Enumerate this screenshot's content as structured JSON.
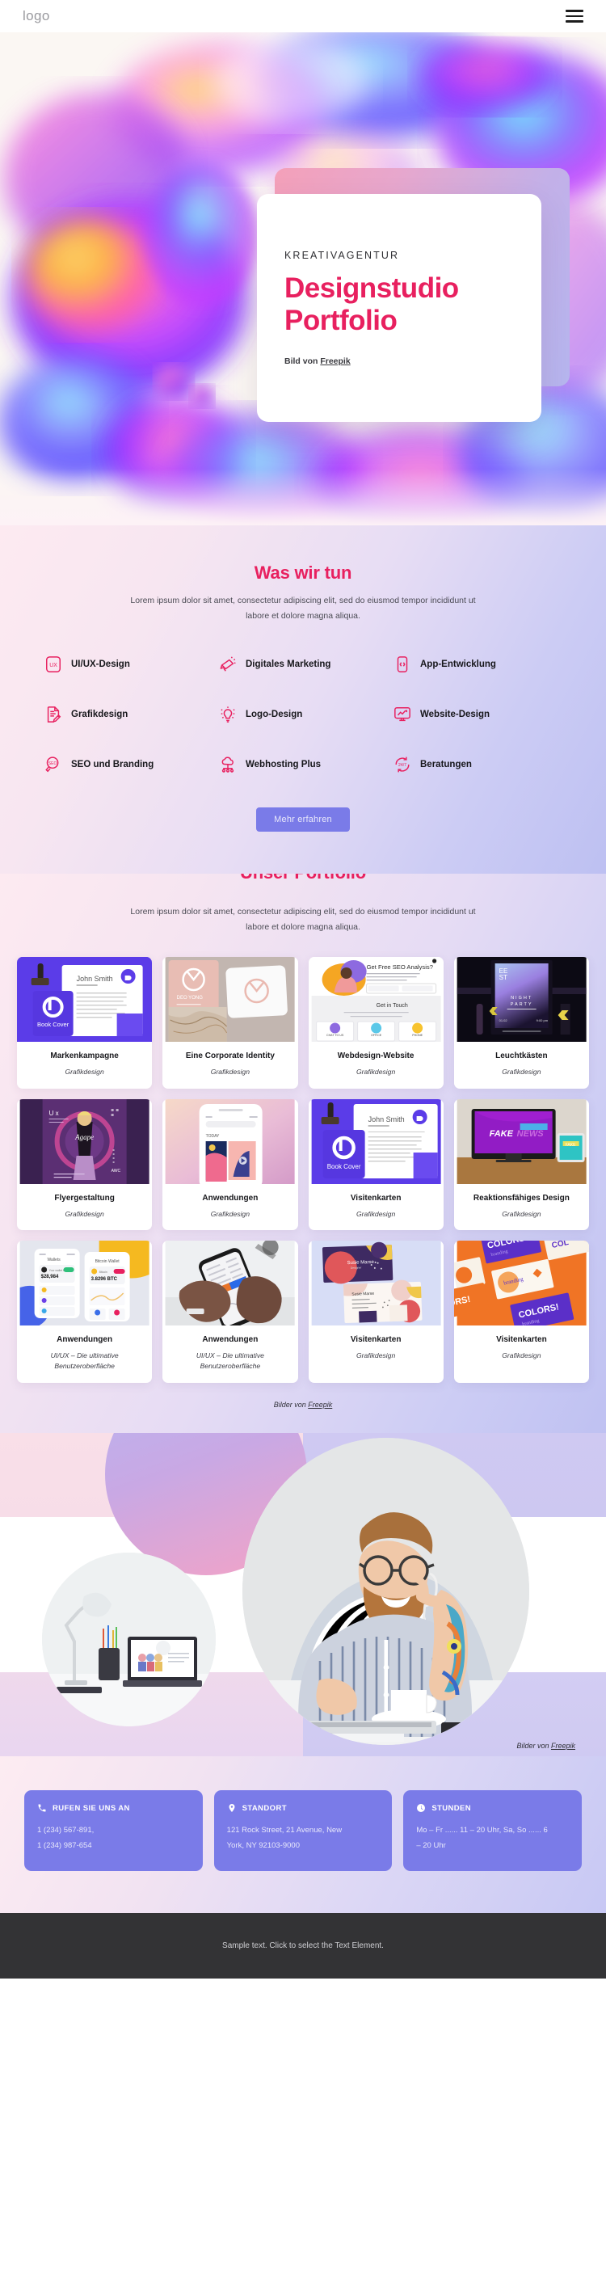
{
  "header": {
    "logo": "logo",
    "menu_icon": "hamburger-menu-icon"
  },
  "hero": {
    "kicker": "KREATIVAGENTUR",
    "title_line1": "Designstudio",
    "title_line2": "Portfolio",
    "credit_prefix": "Bild von ",
    "credit_link": "Freepik"
  },
  "services": {
    "title": "Was wir tun",
    "subtitle": "Lorem ipsum dolor sit amet, consectetur adipiscing elit, sed do eiusmod tempor incididunt ut labore et dolore magna aliqua.",
    "items": [
      {
        "label": "UI/UX-Design",
        "icon": "ux-badge-icon"
      },
      {
        "label": "Digitales Marketing",
        "icon": "megaphone-icon"
      },
      {
        "label": "App-Entwicklung",
        "icon": "mobile-code-icon"
      },
      {
        "label": "Grafikdesign",
        "icon": "document-pen-icon"
      },
      {
        "label": "Logo-Design",
        "icon": "lightbulb-icon"
      },
      {
        "label": "Website-Design",
        "icon": "monitor-chart-icon"
      },
      {
        "label": "SEO und Branding",
        "icon": "seo-magnifier-icon"
      },
      {
        "label": "Webhosting Plus",
        "icon": "cloud-network-icon"
      },
      {
        "label": "Beratungen",
        "icon": "247-refresh-icon"
      }
    ],
    "cta": "Mehr erfahren",
    "accent": "#e8205f",
    "button_color": "#7a7be8"
  },
  "portfolio": {
    "title": "Unser Portfolio",
    "subtitle": "Lorem ipsum dolor sit amet, consectetur adipiscing elit, sed do eiusmod tempor incididunt ut labore et dolore magna aliqua.",
    "credit_prefix": "Bilder von ",
    "credit_link": "Freepik",
    "items": [
      {
        "title": "Markenkampagne",
        "category": "Grafikdesign",
        "art": "brand-stationery"
      },
      {
        "title": "Eine Corporate Identity",
        "category": "Grafikdesign",
        "art": "corporate-identity"
      },
      {
        "title": "Webdesign-Website",
        "category": "Grafikdesign",
        "art": "seo-landing"
      },
      {
        "title": "Leuchtkästen",
        "category": "Grafikdesign",
        "art": "lightbox-poster"
      },
      {
        "title": "Flyergestaltung",
        "category": "Grafikdesign",
        "art": "flyer-purple"
      },
      {
        "title": "Anwendungen",
        "category": "Grafikdesign",
        "art": "phone-mockup"
      },
      {
        "title": "Visitenkarten",
        "category": "Grafikdesign",
        "art": "brand-stationery"
      },
      {
        "title": "Reaktionsfähiges Design",
        "category": "Grafikdesign",
        "art": "fakenews-imac"
      },
      {
        "title": "Anwendungen",
        "category": "UI/UX – Die ultimative Benutzeroberfläche",
        "art": "wallet-apps"
      },
      {
        "title": "Anwendungen",
        "category": "UI/UX – Die ultimative Benutzeroberfläche",
        "art": "hands-phone"
      },
      {
        "title": "Visitenkarten",
        "category": "Grafikdesign",
        "art": "cards-pastel"
      },
      {
        "title": "Visitenkarten",
        "category": "Grafikdesign",
        "art": "colors-orange"
      }
    ]
  },
  "team": {
    "credit_prefix": "Bilder von ",
    "credit_link": "Freepik"
  },
  "contact": {
    "cards": [
      {
        "icon": "phone-icon",
        "title": "RUFEN SIE UNS AN",
        "line1": "1 (234) 567-891,",
        "line2": "1 (234) 987-654"
      },
      {
        "icon": "location-icon",
        "title": "STANDORT",
        "line1": "121 Rock Street, 21 Avenue, New",
        "line2": "York, NY 92103-9000"
      },
      {
        "icon": "clock-icon",
        "title": "STUNDEN",
        "line1": "Mo – Fr ...... 11 – 20 Uhr, Sa, So ...... 6",
        "line2": "– 20 Uhr"
      }
    ]
  },
  "footer": {
    "text": "Sample text. Click to select the Text Element."
  }
}
